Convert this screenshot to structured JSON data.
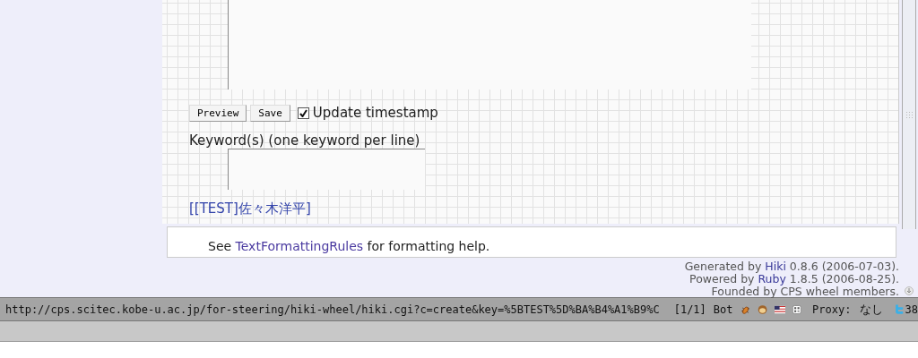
{
  "editor": {
    "buttons": [
      {
        "label": "Preview"
      },
      {
        "label": "Save"
      }
    ],
    "update_timestamp": {
      "label": "Update timestamp",
      "checked": true
    },
    "keywords_label": "Keyword(s) (one keyword per line)",
    "page_link": "[[TEST]佐々木洋平]"
  },
  "help": {
    "before": "See",
    "link": "TextFormattingRules",
    "after": "for formatting help."
  },
  "footer": [
    {
      "before": "Generated by",
      "link": "Hiki",
      "after": "0.8.6 (2006-07-03)."
    },
    {
      "before": "Powered by",
      "link": "Ruby",
      "after": "1.8.5 (2006-08-25)."
    },
    {
      "before": "Founded by CPS wheel members."
    }
  ],
  "status_bar": {
    "url": "http://cps.scitec.kobe-u.ac.jp/for-steering/hiki-wheel/hiki.cgi?c=create&key=%5BTEST%5D%BA%B4%A1%B9%C",
    "position": "[1/1]",
    "scroll": "Bot",
    "proxy_label": "Proxy:",
    "proxy_value": "なし",
    "count": "38"
  }
}
